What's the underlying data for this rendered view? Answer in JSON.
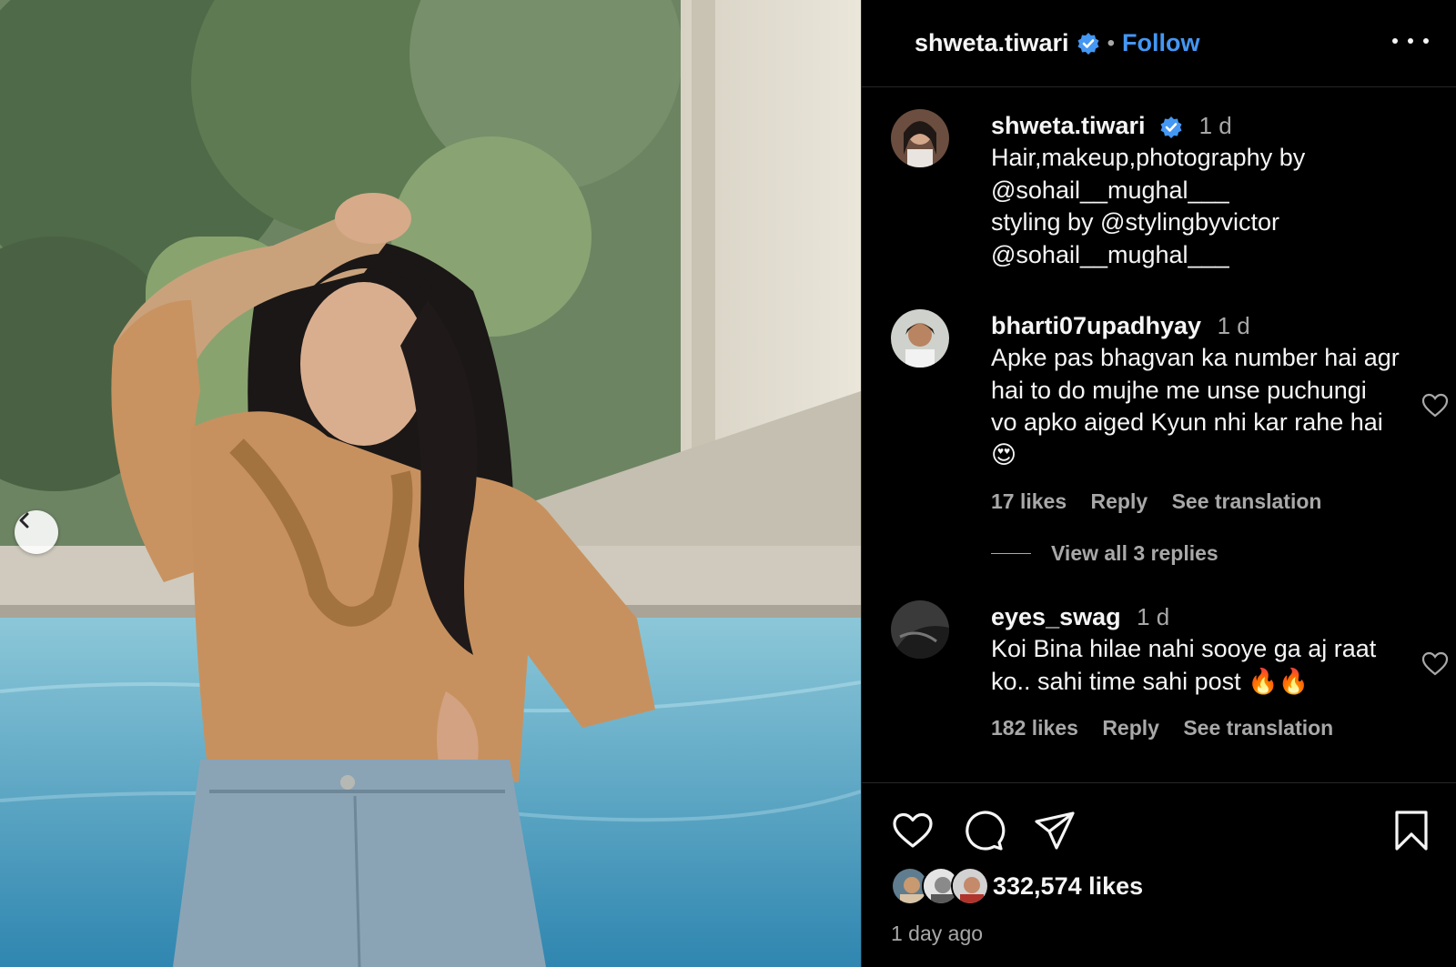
{
  "colors": {
    "background": "#000000",
    "accent": "#4497f3",
    "muted": "#a8a8a8",
    "divider": "#262626"
  },
  "photo": {
    "alt_icon": "chevron-left-icon"
  },
  "header": {
    "username": "shweta.tiwari",
    "separator": "•",
    "follow_label": "Follow",
    "more_icon": "more-horizontal-icon"
  },
  "caption": {
    "username": "shweta.tiwari",
    "time": "1 d",
    "text": "Hair,makeup,photography by\n@sohail__mughal___\nstyling by @stylingbyvictor\n@sohail__mughal___"
  },
  "comments": [
    {
      "username": "bharti07upadhyay",
      "time": "1 d",
      "text": "Apke pas bhagvan ka number hai agr\nhai to do mujhe me unse puchungi\nvo apko aiged Kyun nhi kar rahe hai\n😍",
      "likes": "17 likes",
      "reply": "Reply",
      "translate": "See translation",
      "view_replies": "View all 3 replies"
    },
    {
      "username": "eyes_swag",
      "time": "1 d",
      "text": "Koi Bina hilae nahi sooye ga aj raat\nko.. sahi time sahi post 🔥🔥",
      "likes": "182 likes",
      "reply": "Reply",
      "translate": "See translation"
    }
  ],
  "footer": {
    "likes": "332,574 likes",
    "time_ago": "1 day ago",
    "icons": [
      "heart-icon",
      "comment-icon",
      "share-icon",
      "bookmark-icon"
    ]
  }
}
